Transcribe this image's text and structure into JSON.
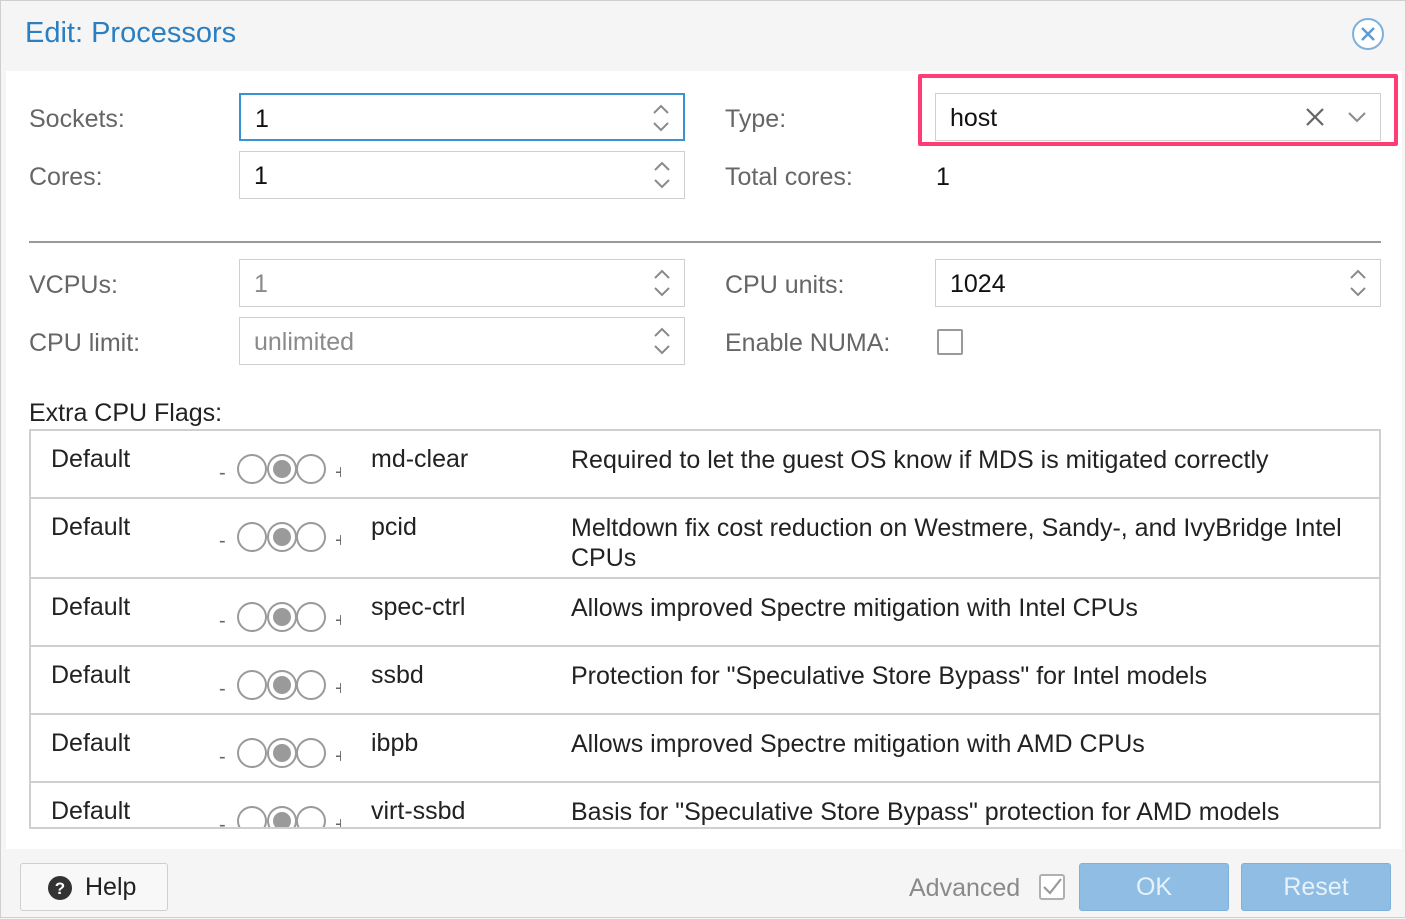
{
  "window": {
    "title": "Edit: Processors"
  },
  "fields": {
    "sockets": {
      "label": "Sockets:",
      "value": "1"
    },
    "cores": {
      "label": "Cores:",
      "value": "1"
    },
    "type": {
      "label": "Type:",
      "value": "host"
    },
    "total_cores": {
      "label": "Total cores:",
      "value": "1"
    },
    "vcpus": {
      "label": "VCPUs:",
      "value": "1"
    },
    "cpu_units": {
      "label": "CPU units:",
      "value": "1024"
    },
    "cpu_limit": {
      "label": "CPU limit:",
      "value": "unlimited"
    },
    "enable_numa": {
      "label": "Enable NUMA:",
      "checked": false
    }
  },
  "flags": {
    "label": "Extra CPU Flags:",
    "minus": "-",
    "plus": "+",
    "rows": [
      {
        "state": "Default",
        "flag": "md-clear",
        "description": "Required to let the guest OS know if MDS is mitigated correctly"
      },
      {
        "state": "Default",
        "flag": "pcid",
        "description": "Meltdown fix cost reduction on Westmere, Sandy-, and IvyBridge Intel CPUs"
      },
      {
        "state": "Default",
        "flag": "spec-ctrl",
        "description": "Allows improved Spectre mitigation with Intel CPUs"
      },
      {
        "state": "Default",
        "flag": "ssbd",
        "description": "Protection for \"Speculative Store Bypass\" for Intel models"
      },
      {
        "state": "Default",
        "flag": "ibpb",
        "description": "Allows improved Spectre mitigation with AMD CPUs"
      },
      {
        "state": "Default",
        "flag": "virt-ssbd",
        "description": "Basis for \"Speculative Store Bypass\" protection for AMD models"
      }
    ]
  },
  "footer": {
    "help_label": "Help",
    "advanced_label": "Advanced",
    "advanced_checked": true,
    "ok_label": "OK",
    "reset_label": "Reset"
  },
  "colors": {
    "title": "#2b7fc1",
    "highlight": "#ff3d74",
    "focus_border": "#3892d4",
    "button_disabled": "#8fbde3"
  }
}
